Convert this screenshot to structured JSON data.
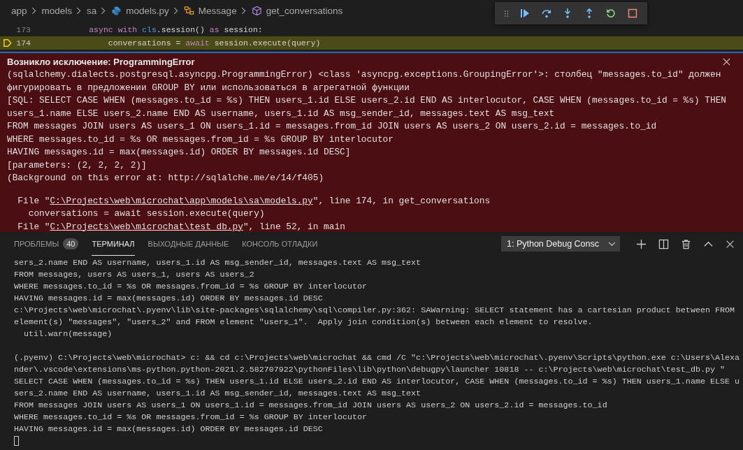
{
  "breadcrumbs": [
    {
      "text": "app",
      "kind": "folder"
    },
    {
      "text": "models",
      "kind": "folder"
    },
    {
      "text": "sa",
      "kind": "folder"
    },
    {
      "text": "models.py",
      "kind": "python"
    },
    {
      "text": "Message",
      "kind": "class"
    },
    {
      "text": "get_conversations",
      "kind": "method"
    }
  ],
  "editor": {
    "lines": [
      {
        "number": "173",
        "current": false,
        "tokens": [
          {
            "t": "        async ",
            "kind": "keyword"
          },
          {
            "t": "with ",
            "kind": "keyword"
          },
          {
            "t": "cls",
            "kind": "self"
          },
          {
            "t": ".session() ",
            "kind": "plain"
          },
          {
            "t": "as",
            "kind": "keyword"
          },
          {
            "t": " session:",
            "kind": "plain"
          }
        ]
      },
      {
        "number": "174",
        "current": true,
        "tokens": [
          {
            "t": "            conversations = ",
            "kind": "plain"
          },
          {
            "t": "await",
            "kind": "keyword"
          },
          {
            "t": " session.execute(query)",
            "kind": "plain"
          }
        ]
      }
    ]
  },
  "exception": {
    "title": "Возникло исключение: ProgrammingError",
    "lines": [
      "(sqlalchemy.dialects.postgresql.asyncpg.ProgrammingError) <class 'asyncpg.exceptions.GroupingError'>: столбец \"messages.to_id\" должен",
      "фигурировать в предложении GROUP BY или использоваться в агрегатной функции",
      "[SQL: SELECT CASE WHEN (messages.to_id = %s) THEN users_1.id ELSE users_2.id END AS interlocutor, CASE WHEN (messages.to_id = %s) THEN",
      "users_1.name ELSE users_2.name END AS username, users_1.id AS msg_sender_id, messages.text AS msg_text",
      "FROM messages JOIN users AS users_1 ON users_1.id = messages.from_id JOIN users AS users_2 ON users_2.id = messages.to_id",
      "WHERE messages.to_id = %s OR messages.from_id = %s GROUP BY interlocutor",
      "HAVING messages.id = max(messages.id) ORDER BY messages.id DESC]",
      "[parameters: (2, 2, 2, 2)]",
      "(Background on this error at: http://sqlalche.me/e/14/f405)"
    ],
    "traceback": [
      {
        "kind": "file",
        "prefix": "  File \"",
        "link": "C:\\Projects\\web\\microchat\\app\\models\\sa\\models.py",
        "suffix": "\", line 174, in get_conversations"
      },
      {
        "kind": "code",
        "text": "    conversations = await session.execute(query)"
      },
      {
        "kind": "file",
        "prefix": "  File \"",
        "link": "C:\\Projects\\web\\microchat\\test_db.py",
        "suffix": "\", line 52, in main"
      }
    ]
  },
  "panel": {
    "tabs": [
      {
        "label": "ПРОБЛЕМЫ",
        "badge": "40",
        "selected": false
      },
      {
        "label": "ТЕРМИНАЛ",
        "selected": true
      },
      {
        "label": "ВЫХОДНЫЕ ДАННЫЕ",
        "selected": false
      },
      {
        "label": "КОНСОЛЬ ОТЛАДКИ",
        "selected": false
      }
    ],
    "terminal_select": "1: Python Debug Consc"
  },
  "terminal": [
    [
      "sers_2.name END AS username, users_1.id AS msg_sender_id, messages.text AS msg_text",
      "FROM messages, users AS users_1, users AS users_2",
      "WHERE messages.to_id = %s OR messages.from_id = %s GROUP BY interlocutor",
      "HAVING messages.id = max(messages.id) ORDER BY messages.id DESC",
      "c:\\Projects\\web\\microchat\\.pyenv\\lib\\site-packages\\sqlalchemy\\sql\\compiler.py:362: SAWarning: SELECT statement has a cartesian product between FROM",
      "element(s) \"messages\", \"users_2\" and FROM element \"users_1\".  Apply join condition(s) between each element to resolve.",
      "  util.warn(message)"
    ],
    [
      "(.pyenv) C:\\Projects\\web\\microchat> c: && cd c:\\Projects\\web\\microchat && cmd /C \"c:\\Projects\\web\\microchat\\.pyenv\\Scripts\\python.exe c:\\Users\\Alexa",
      "nder\\.vscode\\extensions\\ms-python.python-2021.2.582707922\\pythonFiles\\lib\\python\\debugpy\\launcher 10818 -- c:\\Projects\\web\\microchat\\test_db.py \"",
      "SELECT CASE WHEN (messages.to_id = %s) THEN users_1.id ELSE users_2.id END AS interlocutor, CASE WHEN (messages.to_id = %s) THEN users_1.name ELSE u",
      "sers_2.name END AS username, users_1.id AS msg_sender_id, messages.text AS msg_text",
      "FROM messages JOIN users AS users_1 ON users_1.id = messages.from_id JOIN users AS users_2 ON users_2.id = messages.to_id",
      "WHERE messages.to_id = %s OR messages.from_id = %s GROUP BY interlocutor",
      "HAVING messages.id = max(messages.id) ORDER BY messages.id DESC"
    ]
  ]
}
